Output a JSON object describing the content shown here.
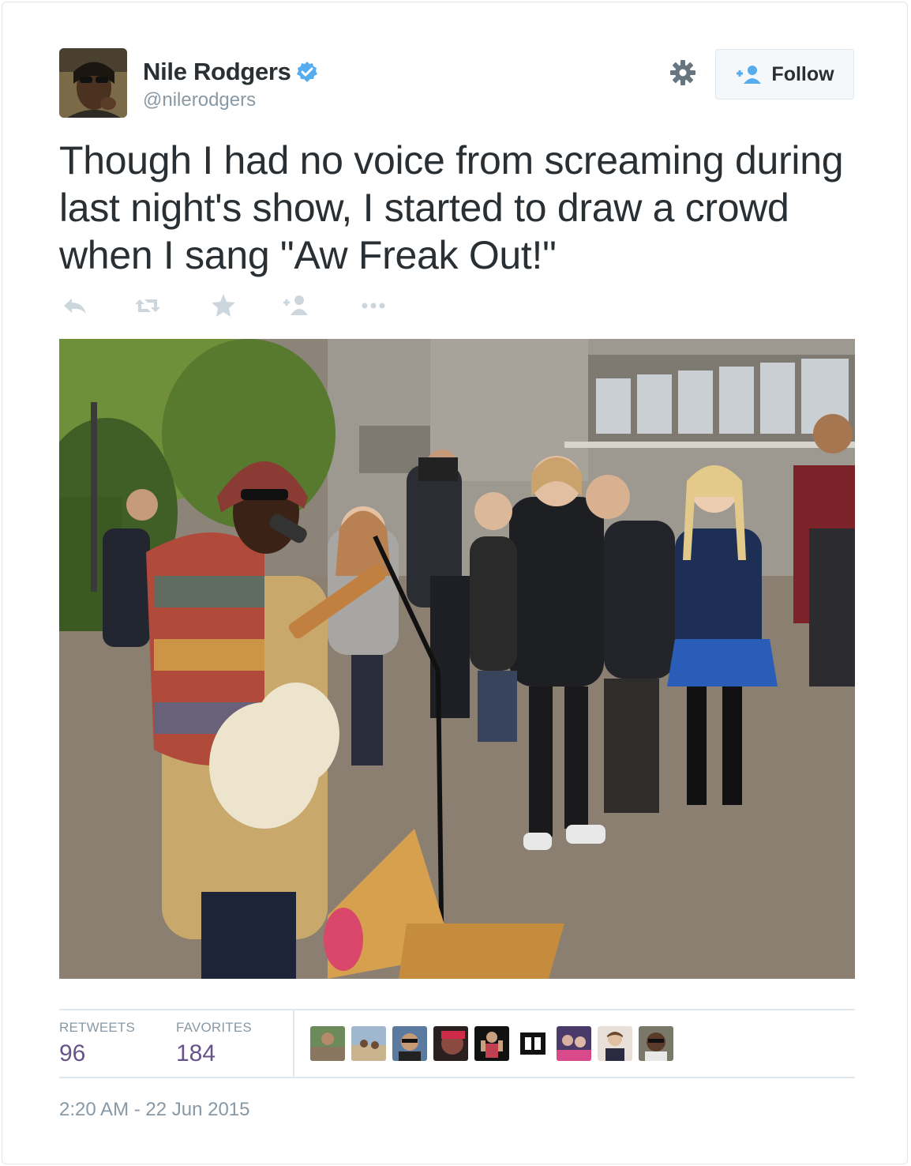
{
  "user": {
    "name": "Nile Rodgers",
    "handle": "@nilerodgers",
    "verified": true
  },
  "follow_button": {
    "label": "Follow"
  },
  "tweet": {
    "text_lines": [
      "Though I had no voice from screaming during",
      "last night's show, I started to draw a crowd",
      "when I sang \"Aw Freak Out!\""
    ]
  },
  "actions": [
    "reply-icon",
    "retweet-icon",
    "favorite-icon",
    "follow-icon",
    "more-icon"
  ],
  "stats": {
    "retweets_label": "RETWEETS",
    "retweets_count": "96",
    "favorites_label": "FAVORITES",
    "favorites_count": "184"
  },
  "favoriter_avatars": 9,
  "timestamp": "2:20 AM - 22 Jun 2015",
  "colors": {
    "text": "#292f33",
    "muted": "#8899a6",
    "accent": "#55acee",
    "stat_value": "#66538a",
    "border": "#e1e8ed"
  }
}
